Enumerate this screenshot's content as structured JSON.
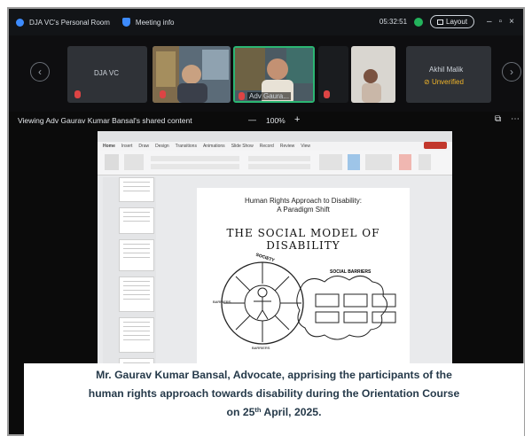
{
  "meeting": {
    "room_title": "DJA VC's Personal Room",
    "meeting_info": "Meeting info",
    "timer": "05:32:51",
    "layout_label": "Layout"
  },
  "participants": [
    {
      "name": "DJA VC"
    },
    {
      "name": "Adv Gaura..."
    },
    {
      "name": "Akhil Malik",
      "status": "Unverified"
    }
  ],
  "share": {
    "viewing_label": "Viewing Adv Gaurav Kumar Bansal's shared content",
    "zoom": "100%",
    "zoom_out": "—",
    "zoom_in": "+"
  },
  "ppt": {
    "tabs": [
      "Home",
      "Insert",
      "Draw",
      "Design",
      "Transitions",
      "Animations",
      "Slide Show",
      "Record",
      "Review",
      "View"
    ]
  },
  "slide": {
    "title_line1": "Human Rights Approach to Disability:",
    "title_line2": "A Paradigm Shift",
    "heading": "THE SOCIAL MODEL OF DISABILITY",
    "circle_top": "SOCIETY",
    "bubble_label": "SOCIAL BARRIERS",
    "side_left": "BARRIERS",
    "side_bottom": "BARRIERS"
  },
  "caption": {
    "line1": "Mr. Gaurav Kumar Bansal, Advocate, apprising the participants of the",
    "line2": "human rights approach towards disability during the Orientation Course",
    "line3_pre": "on 25",
    "line3_sup": "th",
    "line3_post": " April, 2025."
  }
}
